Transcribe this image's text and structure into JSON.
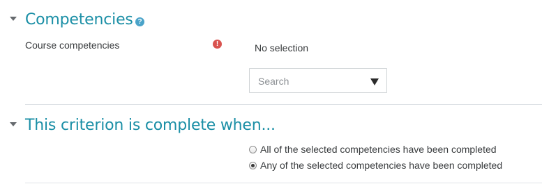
{
  "competencies_section": {
    "title": "Competencies",
    "help_icon": "question-circle-icon",
    "course_competencies_label": "Course competencies",
    "required_icon": "exclamation-circle-icon",
    "selection_value": "No selection",
    "search": {
      "placeholder": "Search",
      "dropdown_icon": "triangle-down-icon"
    }
  },
  "completion_section": {
    "title": "This criterion is complete when...",
    "options": [
      {
        "label": "All of the selected competencies have been completed",
        "checked": false
      },
      {
        "label": "Any of the selected competencies have been completed",
        "checked": true
      }
    ]
  },
  "colors": {
    "heading": "#1b8fa6",
    "help_icon": "#4aa3c9",
    "required_icon": "#d9534f",
    "divider": "#dee2e6"
  }
}
